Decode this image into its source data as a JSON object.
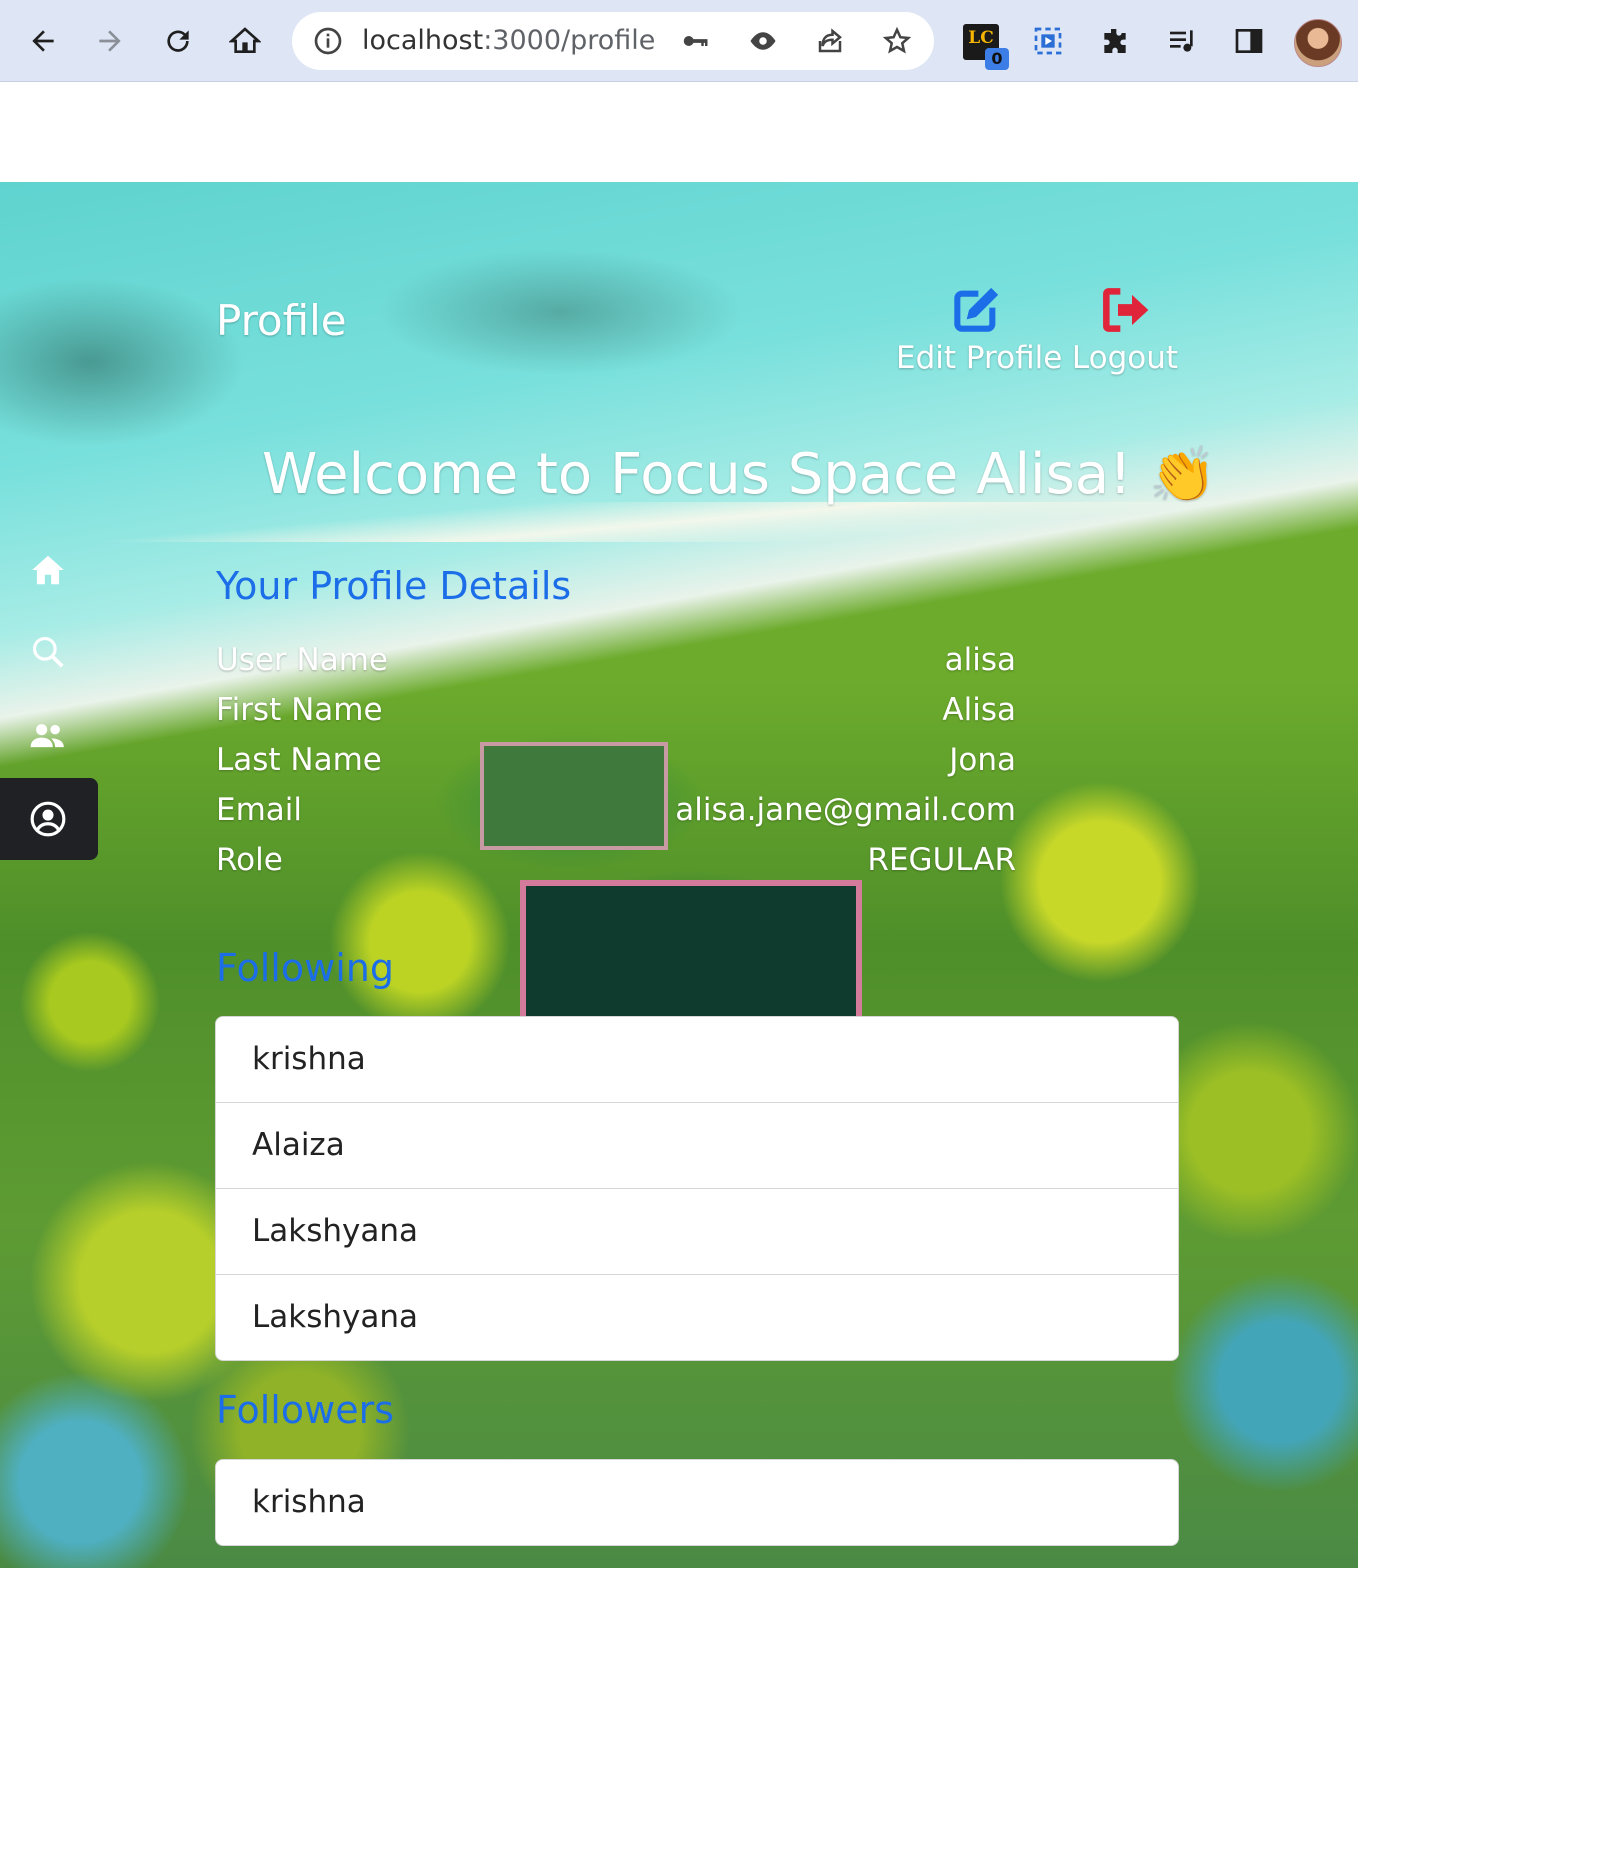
{
  "browser": {
    "url_host": "localhost",
    "url_path": ":3000/profile",
    "extension_badge": "0",
    "extension_label": "LC",
    "icons": [
      "back-icon",
      "forward-icon",
      "reload-icon",
      "home-icon",
      "info-icon",
      "key-icon",
      "eye-icon",
      "share-icon",
      "star-icon",
      "lc-extension-icon",
      "screen-capture-icon",
      "puzzle-icon",
      "media-queue-icon",
      "side-panel-icon"
    ]
  },
  "sidebar": {
    "items": [
      "home-icon",
      "search-icon",
      "users-icon",
      "profile-icon"
    ],
    "active": "profile-icon"
  },
  "header": {
    "title": "Profile",
    "edit_label": "Edit Profile",
    "logout_label": "Logout",
    "edit_color": "#1b6ee8",
    "logout_color": "#e0253a"
  },
  "welcome": {
    "text": "Welcome to Focus Space Alisa!",
    "emoji": "👏"
  },
  "profile_details": {
    "heading": "Your Profile Details",
    "rows": [
      {
        "label": "User Name",
        "value": "alisa"
      },
      {
        "label": "First Name",
        "value": "Alisa"
      },
      {
        "label": "Last Name",
        "value": "Jona"
      },
      {
        "label": "Email",
        "value": "alisa.jane@gmail.com"
      },
      {
        "label": "Role",
        "value": "REGULAR"
      }
    ]
  },
  "following": {
    "heading": "Following",
    "items": [
      "krishna",
      "Alaiza",
      "Lakshyana",
      "Lakshyana"
    ]
  },
  "followers": {
    "heading": "Followers",
    "items": [
      "krishna"
    ]
  }
}
